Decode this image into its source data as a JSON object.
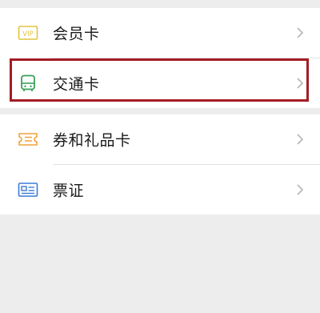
{
  "group_top": {
    "items": [
      {
        "id": "vip",
        "label": "会员卡",
        "icon": "vip-card-icon",
        "icon_color": "#e3c343"
      },
      {
        "id": "transit",
        "label": "交通卡",
        "icon": "bus-icon",
        "icon_color": "#3aa05a"
      }
    ]
  },
  "group_bottom": {
    "items": [
      {
        "id": "coupons",
        "label": "券和礼品卡",
        "icon": "coupon-icon",
        "icon_color": "#f0a23a"
      },
      {
        "id": "tickets",
        "label": "票证",
        "icon": "ticket-id-icon",
        "icon_color": "#3a7bd5"
      }
    ]
  },
  "highlight_color": "#a41c24",
  "chevron_icon": "chevron-right-icon"
}
